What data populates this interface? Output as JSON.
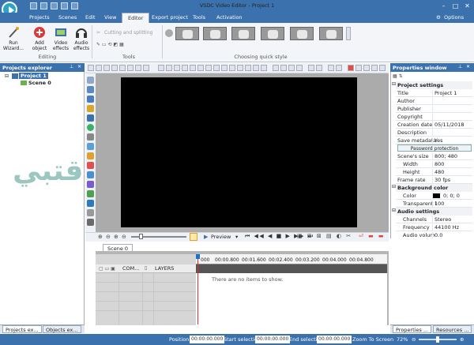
{
  "titlebar": {
    "title": "VSDC Video Editor - Project 1",
    "minimize": "–",
    "maximize": "□",
    "close": "✕"
  },
  "menu": {
    "items": [
      "Projects",
      "Scenes",
      "Edit",
      "View",
      "Editor",
      "Export project",
      "Tools",
      "Activation"
    ],
    "active_index": 4,
    "options": "Options"
  },
  "ribbon": {
    "run_wizard": "Run Wizard...",
    "add_object": "Add object",
    "video_effects": "Video effects",
    "audio_effects": "Audio effects",
    "editing_label": "Editing",
    "cutting_label": "Cutting and splitting",
    "tools_label": "Tools",
    "quick_style_label": "Choosing quick style"
  },
  "explorer": {
    "title": "Projects explorer",
    "pin": "📌",
    "close": "✕",
    "project": "Project 1",
    "scene": "Scene 0"
  },
  "explorer_tabs": [
    "Projects ex...",
    "Objects ex..."
  ],
  "timeline": {
    "preview": "Preview",
    "scene_tab": "Scene 0",
    "track_name": "COM...",
    "layers": "LAYERS",
    "empty_text": "There are no items to show.",
    "ruler": [
      "000",
      "00:00.800",
      "00:01.600",
      "00:02.400",
      "00:03.200",
      "00:04.000",
      "00:04.800"
    ]
  },
  "properties": {
    "title": "Properties window",
    "pin": "📌",
    "close": "✕",
    "section1": "Project settings",
    "rows1": [
      {
        "k": "Title",
        "v": "Project 1"
      },
      {
        "k": "Author",
        "v": ""
      },
      {
        "k": "Publisher",
        "v": ""
      },
      {
        "k": "Copyright",
        "v": ""
      },
      {
        "k": "Creation date",
        "v": "05/11/2018"
      },
      {
        "k": "Description",
        "v": ""
      },
      {
        "k": "Save metadata",
        "v": "Yes"
      }
    ],
    "password_btn": "Password protection",
    "rows2": [
      {
        "k": "Scene's size",
        "v": "800; 480"
      },
      {
        "k": "Width",
        "v": "800"
      },
      {
        "k": "Height",
        "v": "480"
      },
      {
        "k": "Frame rate",
        "v": "30 fps"
      }
    ],
    "section2": "Background color",
    "rows3": [
      {
        "k": "Color",
        "v": "0; 0; 0"
      },
      {
        "k": "Transparent l",
        "v": "100"
      }
    ],
    "section3": "Audio settings",
    "rows4": [
      {
        "k": "Channels",
        "v": "Stereo"
      },
      {
        "k": "Frequency",
        "v": "44100 Hz"
      },
      {
        "k": "Audio volum",
        "v": "0.0"
      }
    ]
  },
  "props_tabs": [
    "Properties ...",
    "Resources ..."
  ],
  "status": {
    "position_label": "Position:",
    "position_value": "00:00:00.000",
    "start_label": "Start selection:",
    "start_value": "00:00:00.000",
    "end_label": "End selection:",
    "end_value": "00:00:00.000",
    "zoom_label": "Zoom To Screen",
    "zoom_value": "72%"
  },
  "watermark": "اقتبي",
  "colors": {
    "accent": "#3b71ad",
    "canvas": "#000000"
  }
}
